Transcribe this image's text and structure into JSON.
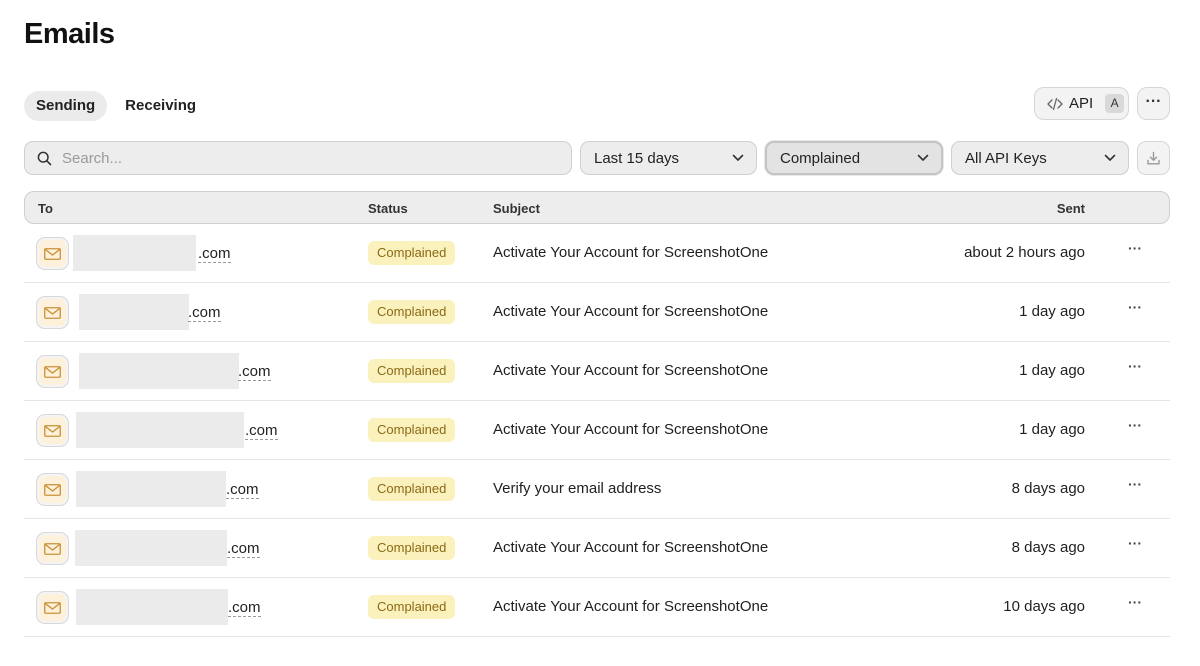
{
  "page": {
    "title": "Emails"
  },
  "tabs": [
    {
      "label": "Sending",
      "active": true
    },
    {
      "label": "Receiving",
      "active": false
    }
  ],
  "toolbar": {
    "api_label": "API",
    "api_shortcut": "A",
    "more_label": "···"
  },
  "filters": {
    "search_placeholder": "Search...",
    "date_range": "Last 15 days",
    "status": "Complained",
    "api_keys": "All API Keys"
  },
  "table": {
    "columns": {
      "to": "To",
      "status": "Status",
      "subject": "Subject",
      "sent": "Sent"
    },
    "rows": [
      {
        "to_domain": ".com",
        "status": "Complained",
        "subject": "Activate Your Account for ScreenshotOne",
        "sent": "about 2 hours ago"
      },
      {
        "to_domain": ".com",
        "status": "Complained",
        "subject": "Activate Your Account for ScreenshotOne",
        "sent": "1 day ago"
      },
      {
        "to_domain": ".com",
        "status": "Complained",
        "subject": "Activate Your Account for ScreenshotOne",
        "sent": "1 day ago"
      },
      {
        "to_domain": ".com",
        "status": "Complained",
        "subject": "Activate Your Account for ScreenshotOne",
        "sent": "1 day ago"
      },
      {
        "to_domain": ".com",
        "status": "Complained",
        "subject": "Verify your email address",
        "sent": "8 days ago"
      },
      {
        "to_domain": ".com",
        "status": "Complained",
        "subject": "Activate Your Account for ScreenshotOne",
        "sent": "8 days ago"
      },
      {
        "to_domain": ".com",
        "status": "Complained",
        "subject": "Activate Your Account for ScreenshotOne",
        "sent": "10 days ago"
      }
    ],
    "row_more_label": "···"
  },
  "colors": {
    "badge_bg": "#fbf1bd",
    "badge_text": "#8a6a14",
    "mail_icon_bg": "#fdf1dc",
    "mail_icon_stroke": "#c9913a"
  },
  "icons": {
    "search": "search-icon",
    "chevron": "chevron-down-icon",
    "code": "code-icon",
    "download": "download-icon",
    "mail": "mail-icon",
    "more": "more-horizontal-icon"
  }
}
